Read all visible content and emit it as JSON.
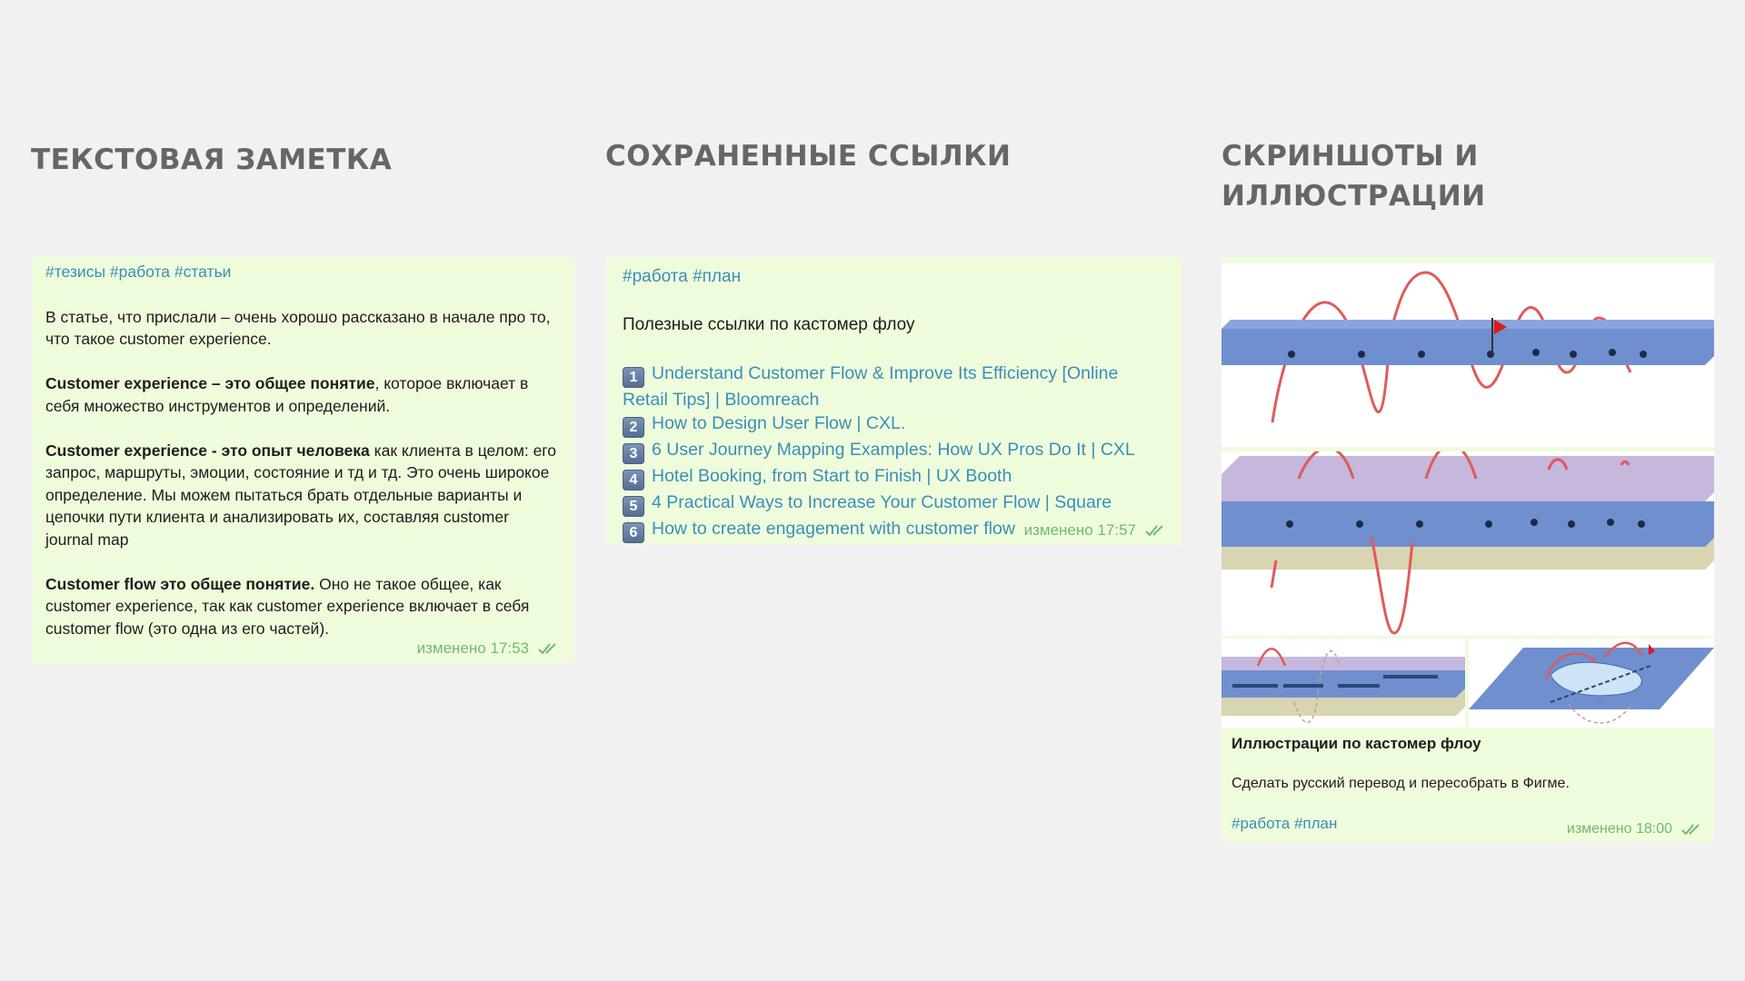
{
  "columns": {
    "text_note": {
      "heading": "ТЕКСТОВАЯ ЗАМЕТКА",
      "tags": "#тезисы #работа #статьи",
      "paragraphs": [
        {
          "bold": "",
          "text": "В статье, что прислали – очень хорошо рассказано в начале про то, что такое customer experience."
        },
        {
          "bold": "Customer experience – это общее понятие",
          "text": ", которое включает в себя множество инструментов и определений."
        },
        {
          "bold": "Customer experience - это опыт человека",
          "text": " как клиента в целом: его запрос, маршруты, эмоции, состояние и тд и тд. Это очень широкое определение. Мы можем пытаться брать отдельные варианты и цепочки пути клиента и анализировать их, составляя customer journal map"
        },
        {
          "bold": "Customer flow это общее понятие.",
          "text": " Оно не такое общее, как customer experience, так как customer experience включает в себя customer flow (это одна из его частей)."
        }
      ],
      "status": "изменено 17:53"
    },
    "saved_links": {
      "heading": "СОХРАНЕННЫЕ ССЫЛКИ",
      "tags": "#работа #план",
      "title": "Полезные ссылки по кастомер флоу",
      "links": [
        {
          "num": "1",
          "label": "Understand Customer Flow & Improve Its Efficiency [Online Retail Tips] | Bloomreach"
        },
        {
          "num": "2",
          "label": "How to Design User Flow | CXL."
        },
        {
          "num": "3",
          "label": "6 User Journey Mapping Examples: How UX Pros Do It | CXL"
        },
        {
          "num": "4",
          "label": "Hotel Booking, from Start to Finish | UX Booth"
        },
        {
          "num": "5",
          "label": "4 Practical Ways to Increase Your Customer Flow | Square"
        },
        {
          "num": "6",
          "label": "How to create engagement with customer flow"
        }
      ],
      "status": "изменено 17:57"
    },
    "screenshots": {
      "heading": "СКРИНШОТЫ И ИЛЛЮСТРАЦИИ",
      "title": "Иллюстрации по кастомер флоу",
      "description": "Сделать русский перевод и пересобрать в Фигме.",
      "tags": "#работа #план",
      "status": "изменено 18:00"
    }
  },
  "colors": {
    "card_bg": "#eefcdc",
    "tag": "#3a8fb8",
    "status": "#75b86e",
    "heading": "#666666",
    "wave": "#e05a5a",
    "plane": "#6f8fcf"
  }
}
